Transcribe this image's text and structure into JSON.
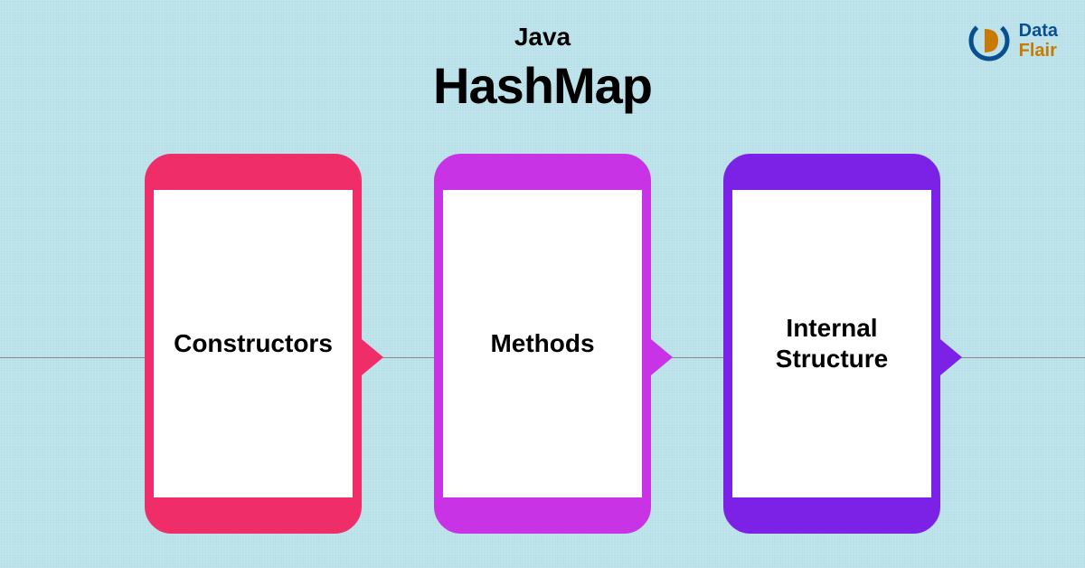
{
  "header": {
    "subtitle": "Java",
    "title": "HashMap"
  },
  "logo": {
    "line1": "Data",
    "line2": "Flair"
  },
  "cards": [
    {
      "label": "Constructors",
      "color": "#ef2d68"
    },
    {
      "label": "Methods",
      "color": "#c933e6"
    },
    {
      "label": "Internal Structure",
      "color": "#7c22e6"
    }
  ]
}
